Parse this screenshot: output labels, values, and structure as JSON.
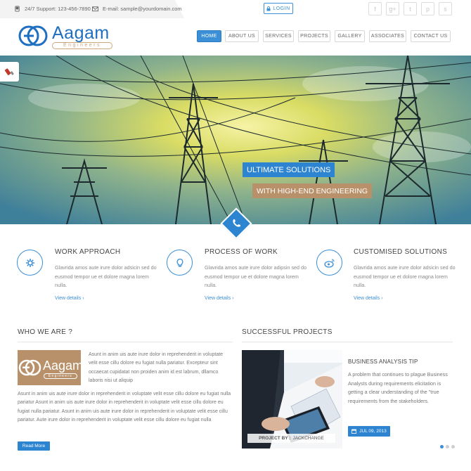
{
  "topbar": {
    "support": "24/7 Support: 123-456-7890",
    "email": "E-mail: sample@yourdomain.com",
    "login": "LOGIN",
    "social": [
      {
        "icon": "facebook-icon",
        "glyph": "f"
      },
      {
        "icon": "google-plus-icon",
        "glyph": "g+"
      },
      {
        "icon": "twitter-icon",
        "glyph": "t"
      },
      {
        "icon": "pinterest-icon",
        "glyph": "p"
      },
      {
        "icon": "skype-icon",
        "glyph": "s"
      }
    ]
  },
  "logo": {
    "name": "Aagam",
    "sub": "Engineers"
  },
  "nav": [
    "HOME",
    "ABOUT US",
    "SERVICES",
    "PROJECTS",
    "GALLERY",
    "ASSOCIATES",
    "CONTACT US"
  ],
  "nav_active": "HOME",
  "hero": {
    "caption1": "ULTIMATE SOLUTIONS",
    "caption2": "WITH HIGH-END ENGINEERING"
  },
  "features": [
    {
      "icon": "gear-icon",
      "title": "WORK APPROACH",
      "text": "Glavrida amos aute irure dolor adsicin sed do eusmod tempor ue et dolore magna lorem nulla.",
      "link": "View details"
    },
    {
      "icon": "lightbulb-icon",
      "title": "PROCESS OF WORK",
      "text": "Glavrida amos aute irure dolor adipsin sed do eusmod tempor ue et dolore magna lorem nulla.",
      "link": "View details"
    },
    {
      "icon": "weibo-icon",
      "title": "CUSTOMISED SOLUTIONS",
      "text": "Glavrida amos aute irure dolor adsicin sed do eusmod tempor ue et dolore magna lorem nulla.",
      "link": "View details"
    }
  ],
  "who": {
    "title": "WHO WE ARE ?",
    "intro": "Asunt in anim uis aute irure dolor in reprehenderit in voluptate velit esse cillu dolore eu fugiat nulla pariatur. Excepteur sint occaecat cupidatat non proiden anim id est labrum, dllamco laboris nisi ut aliquip",
    "body": "Asunt in anim uis aute irure dolor in reprehenderit in voluptate velit esse cillu dolore eu fugiat nulla pariatur Asunt in anim uis aute irure dolor in reprehenderit in voluptate velit esse cillu dolore eu fugiat nulla pariatur. Asunt in anim uis aute irure dolor in reprehenderit in voluptate velit esse cillu pariatur. Aute irure dolor in reprehenderit in voluptate velit esse cillu dolore eu fugiat nulla",
    "read_more": "Read More"
  },
  "projects": {
    "title": "SUCCESSFUL PROJECTS",
    "item_title": "BUSINESS ANALYSIS TIP",
    "item_text": "A problem that continues to plague Business Analysts during requirements elicitation is getting a clear understanding of the \"true requirements from the stakeholders.",
    "project_by_label": "PROJECT BY :",
    "project_by_value": "JACKCHANGE",
    "date": "JUL 09, 2013"
  },
  "colors": {
    "accent": "#2d84d1",
    "brand_gold": "#b8916a"
  }
}
